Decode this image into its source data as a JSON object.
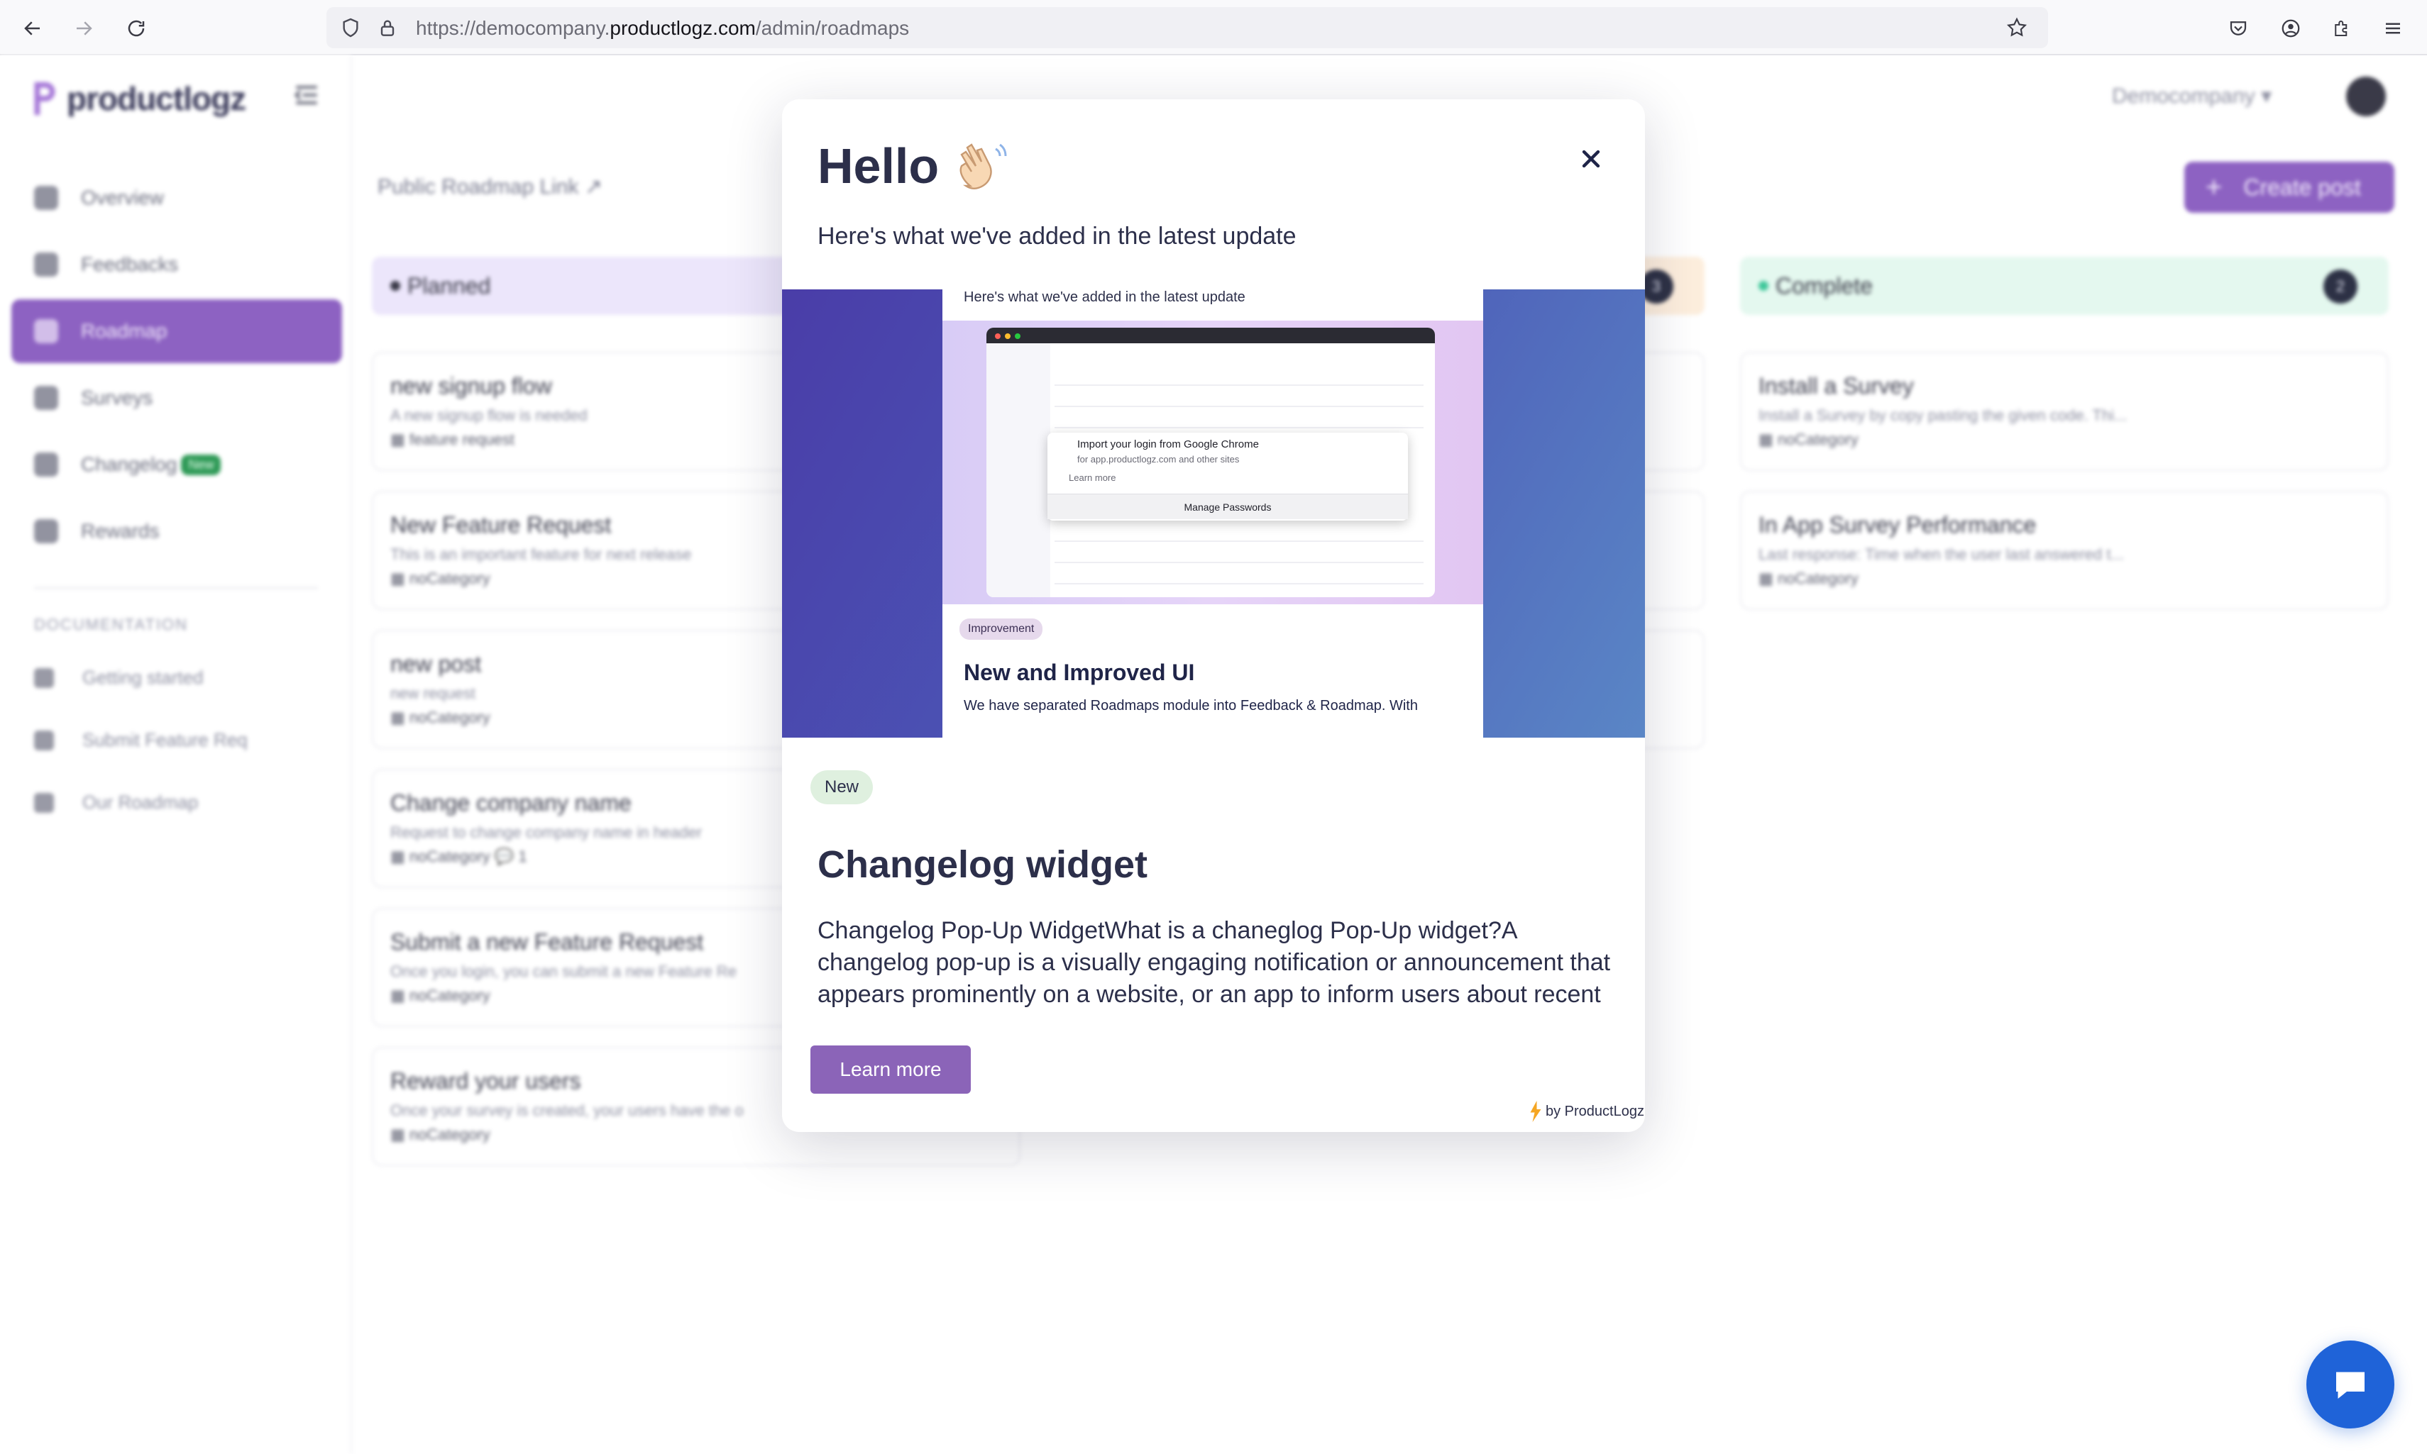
{
  "browser": {
    "url_prefix": "https://democompany.",
    "url_host": "productlogz.com",
    "url_path": "/admin/roadmaps"
  },
  "app": {
    "logo_text": "productlogz",
    "company": "Democompany ▾",
    "public_link": "Public Roadmap Link",
    "create_button": "Create post",
    "sidebar": {
      "items": [
        {
          "label": "Overview"
        },
        {
          "label": "Feedbacks"
        },
        {
          "label": "Roadmap"
        },
        {
          "label": "Surveys"
        },
        {
          "label": "Changelog",
          "badge": "New"
        },
        {
          "label": "Rewards"
        }
      ],
      "section_label": "DOCUMENTATION",
      "docs": [
        {
          "label": "Getting started"
        },
        {
          "label": "Submit Feature Req"
        },
        {
          "label": "Our Roadmap"
        }
      ]
    },
    "columns": {
      "planned": {
        "label": "Planned"
      },
      "progress": {
        "count": "3"
      },
      "complete": {
        "label": "Complete",
        "count": "2"
      }
    },
    "planned_cards": [
      {
        "title": "new signup flow",
        "desc": "A new signup flow is needed",
        "cat": "feature request"
      },
      {
        "title": "New Feature Request",
        "desc": "This is an important feature for next release",
        "cat": "noCategory"
      },
      {
        "title": "new post",
        "desc": "new request",
        "cat": "noCategory"
      },
      {
        "title": "Change company name",
        "desc": "Request to change company name in header",
        "cat": "noCategory",
        "comments": "1"
      },
      {
        "title": "Submit a new Feature Request",
        "desc": "Once you login, you can submit a new Feature Re",
        "cat": "noCategory"
      },
      {
        "title": "Reward your users",
        "desc": "Once your survey is created, your users have the o",
        "cat": "noCategory"
      }
    ],
    "complete_cards": [
      {
        "title": "Install a Survey",
        "desc": "Install a Survey by copy pasting the given code. Thi...",
        "cat": "noCategory"
      },
      {
        "title": "In App Survey Performance",
        "desc": "Last response: Time when the user last answered t...",
        "cat": "noCategory"
      }
    ]
  },
  "modal": {
    "title": "Hello",
    "subtitle": "Here's what we've added in the latest update",
    "banner": {
      "inner_subtitle": "Here's what we've added in the latest update",
      "popup_line1": "Import your login from Google Chrome",
      "popup_line2": "for app.productlogz.com and other sites",
      "popup_line3": "Learn more",
      "popup_button": "Manage Passwords",
      "badge": "Improvement",
      "title": "New and Improved UI",
      "desc": "We have separated Roadmaps module into Feedback & Roadmap. With"
    },
    "badge": "New",
    "post_title": "Changelog widget",
    "post_desc": "Changelog Pop-Up WidgetWhat is a chaneglog Pop-Up widget?A changelog pop-up is a visually engaging notification or announcement that appears prominently on a website, or an app to inform users about recent chang...",
    "learn_more": "Learn more",
    "powered_by": "by ProductLogz"
  },
  "colors": {
    "accent": "#8b64b8",
    "modal_text": "#2c2f4a",
    "chat_button": "#1f63d8"
  }
}
